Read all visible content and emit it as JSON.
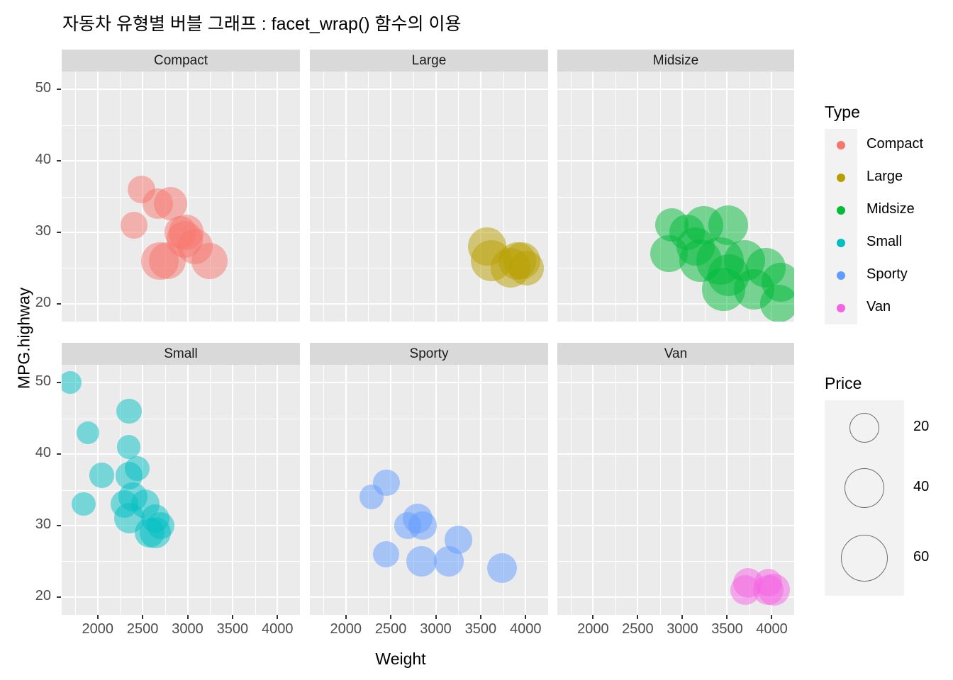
{
  "title": "자동차 유형별 버블 그래프 : facet_wrap() 함수의 이용",
  "axes": {
    "x_title": "Weight",
    "y_title": "MPG.highway",
    "x_ticks": [
      "2000",
      "2500",
      "3000",
      "3500",
      "4000"
    ],
    "y_ticks": [
      "50",
      "40",
      "30",
      "20"
    ],
    "x_range": [
      1600,
      4250
    ],
    "y_range": [
      17.5,
      52.5
    ]
  },
  "legends": {
    "color": {
      "title": "Type",
      "items": [
        {
          "label": "Compact",
          "color": "#F8766D"
        },
        {
          "label": "Large",
          "color": "#B79F00"
        },
        {
          "label": "Midsize",
          "color": "#00BA38"
        },
        {
          "label": "Small",
          "color": "#00BFC4"
        },
        {
          "label": "Sporty",
          "color": "#619CFF"
        },
        {
          "label": "Van",
          "color": "#F564E3"
        }
      ]
    },
    "size": {
      "title": "Price",
      "items": [
        {
          "label": "20",
          "value": 20
        },
        {
          "label": "40",
          "value": 40
        },
        {
          "label": "60",
          "value": 60
        }
      ]
    }
  },
  "chart_data": {
    "type": "scatter",
    "title": "자동차 유형별 버블 그래프 : facet_wrap() 함수의 이용",
    "xlabel": "Weight",
    "ylabel": "MPG.highway",
    "xlim": [
      1600,
      4250
    ],
    "ylim": [
      17.5,
      52.5
    ],
    "grid": true,
    "legend_position": "right",
    "size_variable": "Price",
    "size_breaks": [
      20,
      40,
      60
    ],
    "color_variable": "Type",
    "facet": "facet_wrap(~Type)",
    "facets": [
      {
        "name": "Compact",
        "color": "#F8766D",
        "points": [
          {
            "Weight": 2490,
            "MPG.highway": 36,
            "Price": 15.9
          },
          {
            "Weight": 2405,
            "MPG.highway": 31,
            "Price": 13.9
          },
          {
            "Weight": 2670,
            "MPG.highway": 34,
            "Price": 20.2
          },
          {
            "Weight": 2810,
            "MPG.highway": 34,
            "Price": 26.3
          },
          {
            "Weight": 2985,
            "MPG.highway": 30,
            "Price": 29.5
          },
          {
            "Weight": 2970,
            "MPG.highway": 29,
            "Price": 31.9
          },
          {
            "Weight": 3085,
            "MPG.highway": 28,
            "Price": 30.0
          },
          {
            "Weight": 2690,
            "MPG.highway": 26,
            "Price": 34.7
          },
          {
            "Weight": 2775,
            "MPG.highway": 26,
            "Price": 33.9
          },
          {
            "Weight": 3245,
            "MPG.highway": 26,
            "Price": 31.5
          },
          {
            "Weight": 2920,
            "MPG.highway": 30,
            "Price": 23.7
          }
        ]
      },
      {
        "name": "Large",
        "color": "#B79F00",
        "points": [
          {
            "Weight": 3570,
            "MPG.highway": 28,
            "Price": 36.1
          },
          {
            "Weight": 3620,
            "MPG.highway": 26,
            "Price": 44.6
          },
          {
            "Weight": 3910,
            "MPG.highway": 26,
            "Price": 35.2
          },
          {
            "Weight": 3960,
            "MPG.highway": 26,
            "Price": 33.0
          },
          {
            "Weight": 4010,
            "MPG.highway": 25,
            "Price": 28.0
          },
          {
            "Weight": 3830,
            "MPG.highway": 25,
            "Price": 40.1
          }
        ]
      },
      {
        "name": "Midsize",
        "color": "#00BA38",
        "points": [
          {
            "Weight": 2880,
            "MPG.highway": 31,
            "Price": 25.8
          },
          {
            "Weight": 3050,
            "MPG.highway": 30,
            "Price": 30.0
          },
          {
            "Weight": 3240,
            "MPG.highway": 31,
            "Price": 37.7
          },
          {
            "Weight": 3510,
            "MPG.highway": 31,
            "Price": 40.1
          },
          {
            "Weight": 2850,
            "MPG.highway": 27,
            "Price": 33.9
          },
          {
            "Weight": 3145,
            "MPG.highway": 28,
            "Price": 36.0
          },
          {
            "Weight": 3200,
            "MPG.highway": 26,
            "Price": 47.9
          },
          {
            "Weight": 3420,
            "MPG.highway": 26,
            "Price": 61.9
          },
          {
            "Weight": 3695,
            "MPG.highway": 26,
            "Price": 44.6
          },
          {
            "Weight": 3515,
            "MPG.highway": 24,
            "Price": 45.9
          },
          {
            "Weight": 3930,
            "MPG.highway": 25,
            "Price": 40.1
          },
          {
            "Weight": 4100,
            "MPG.highway": 23,
            "Price": 38.0
          },
          {
            "Weight": 3800,
            "MPG.highway": 22,
            "Price": 42.0
          },
          {
            "Weight": 4080,
            "MPG.highway": 20,
            "Price": 34.3
          },
          {
            "Weight": 3460,
            "MPG.highway": 22,
            "Price": 48.4
          }
        ]
      },
      {
        "name": "Small",
        "color": "#00BFC4",
        "points": [
          {
            "Weight": 1695,
            "MPG.highway": 50,
            "Price": 8.4
          },
          {
            "Weight": 1890,
            "MPG.highway": 43,
            "Price": 9.0
          },
          {
            "Weight": 2350,
            "MPG.highway": 46,
            "Price": 12.2
          },
          {
            "Weight": 2345,
            "MPG.highway": 41,
            "Price": 10.0
          },
          {
            "Weight": 2045,
            "MPG.highway": 37,
            "Price": 12.2
          },
          {
            "Weight": 2350,
            "MPG.highway": 37,
            "Price": 15.1
          },
          {
            "Weight": 2440,
            "MPG.highway": 38,
            "Price": 11.1
          },
          {
            "Weight": 2295,
            "MPG.highway": 33,
            "Price": 15.7
          },
          {
            "Weight": 2390,
            "MPG.highway": 34,
            "Price": 18.2
          },
          {
            "Weight": 1845,
            "MPG.highway": 33,
            "Price": 10.1
          },
          {
            "Weight": 2350,
            "MPG.highway": 31,
            "Price": 20.3
          },
          {
            "Weight": 2530,
            "MPG.highway": 33,
            "Price": 17.3
          },
          {
            "Weight": 2640,
            "MPG.highway": 31,
            "Price": 16.5
          },
          {
            "Weight": 2575,
            "MPG.highway": 29,
            "Price": 19.3
          },
          {
            "Weight": 2700,
            "MPG.highway": 30,
            "Price": 14.9
          },
          {
            "Weight": 2640,
            "MPG.highway": 29,
            "Price": 21.2
          }
        ]
      },
      {
        "name": "Sporty",
        "color": "#619CFF",
        "points": [
          {
            "Weight": 2285,
            "MPG.highway": 34,
            "Price": 11.1
          },
          {
            "Weight": 2450,
            "MPG.highway": 36,
            "Price": 14.1
          },
          {
            "Weight": 2800,
            "MPG.highway": 31,
            "Price": 19.1
          },
          {
            "Weight": 2855,
            "MPG.highway": 30,
            "Price": 15.9
          },
          {
            "Weight": 2690,
            "MPG.highway": 30,
            "Price": 14.0
          },
          {
            "Weight": 2445,
            "MPG.highway": 26,
            "Price": 13.4
          },
          {
            "Weight": 2840,
            "MPG.highway": 25,
            "Price": 20.0
          },
          {
            "Weight": 3250,
            "MPG.highway": 28,
            "Price": 15.9
          },
          {
            "Weight": 3145,
            "MPG.highway": 25,
            "Price": 19.5
          },
          {
            "Weight": 3735,
            "MPG.highway": 24,
            "Price": 19.0
          }
        ]
      },
      {
        "name": "Van",
        "color": "#F564E3",
        "points": [
          {
            "Weight": 3735,
            "MPG.highway": 22,
            "Price": 19.1
          },
          {
            "Weight": 3705,
            "MPG.highway": 21,
            "Price": 19.0
          },
          {
            "Weight": 3960,
            "MPG.highway": 22,
            "Price": 16.3
          },
          {
            "Weight": 3960,
            "MPG.highway": 21,
            "Price": 19.5
          },
          {
            "Weight": 4025,
            "MPG.highway": 21,
            "Price": 22.7
          }
        ]
      }
    ]
  }
}
